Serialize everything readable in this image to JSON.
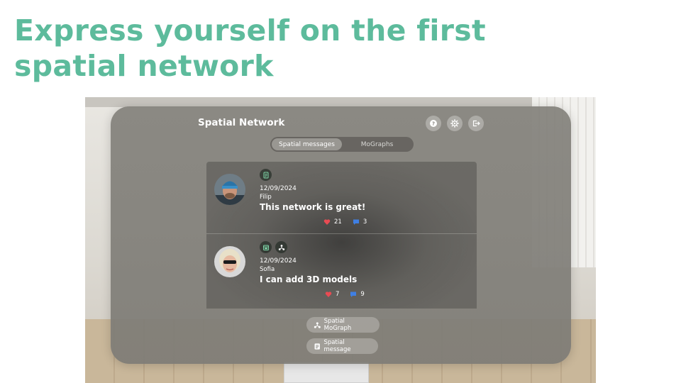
{
  "headline": {
    "line1": "Express yourself on the first",
    "line2": "spatial network"
  },
  "colors": {
    "accent": "#5dbb9c",
    "like": "#e84b53",
    "comment": "#3f7fe3"
  },
  "app": {
    "title": "Spatial Network",
    "toolbar_icons": [
      "help-icon",
      "settings-icon",
      "logout-icon"
    ],
    "tabs": [
      {
        "label": "Spatial messages",
        "active": true
      },
      {
        "label": "MoGraphs",
        "active": false
      }
    ],
    "posts": [
      {
        "author": "Filip",
        "date": "12/09/2024",
        "message": "This network is great!",
        "likes": "21",
        "comments": "3",
        "badges": [
          "document-icon"
        ]
      },
      {
        "author": "Sofia",
        "date": "12/09/2024",
        "message": "I can add 3D models",
        "likes": "7",
        "comments": "9",
        "badges": [
          "calendar-icon",
          "mograph-icon"
        ]
      }
    ],
    "actions": {
      "mograph_label": "Spatial MoGraph",
      "message_label": "Spatial message"
    }
  }
}
